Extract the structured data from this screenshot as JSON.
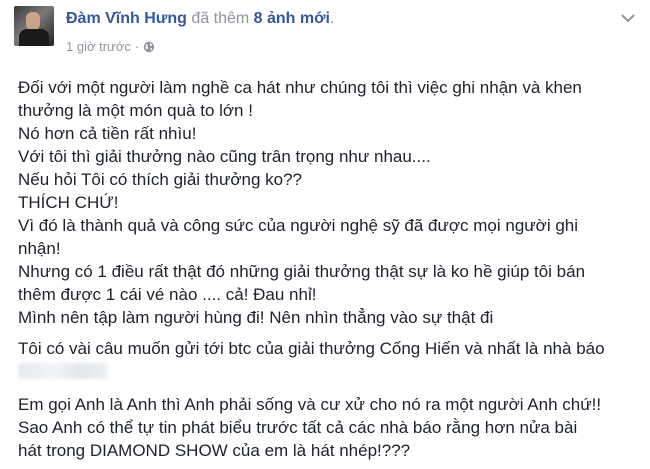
{
  "post": {
    "author": "Đàm Vĩnh Hưng",
    "action_prefix": "đã thêm",
    "action_count": "8 ảnh mới",
    "action_suffix": ".",
    "timestamp": "1 giờ trước",
    "separator": "·",
    "privacy_icon": "globe-icon",
    "menu_icon": "chevron-down-icon",
    "paragraph1": [
      "Đối với một người làm nghề ca hát như chúng tôi thì việc ghi nhận và khen",
      "thưởng là một món quà to lớn !",
      "Nó hơn cả tiền rất nhìu!",
      "Với tôi thì giải thưởng nào cũng trân trọng như nhau....",
      "Nếu hỏi Tôi có thích giải thưởng ko??",
      "THÍCH CHỨ!",
      "Vì đó là thành quả và công sức của người nghệ sỹ đã được mọi người ghi",
      "nhận!",
      "Nhưng có 1 điều rất thật đó những giải thưởng thật sự là ko hề giúp tôi bán",
      "thêm được 1 cái vé nào .... cả! Đau nhỉ!",
      "Mình nên tập làm người hùng đi! Nên nhìn thẳng vào sự thật đi"
    ],
    "paragraph2": [
      "Tôi có vài câu muốn gửi tới btc của giải thưởng Cống Hiến và nhất là nhà báo"
    ],
    "paragraph3": [
      "Em gọi Anh là Anh thì Anh phải sống và cư xử cho nó ra một người Anh chứ!!",
      "Sao Anh có thể tự tin phát biểu trước tất cả các nhà báo rằng hơn nửa bài",
      "hát trong DIAMOND SHOW của em là hát nhép!???"
    ]
  }
}
